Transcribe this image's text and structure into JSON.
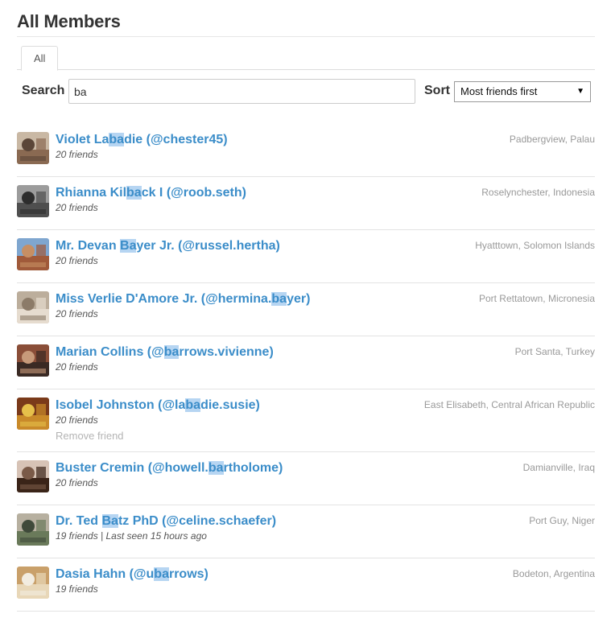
{
  "page": {
    "title": "All Members"
  },
  "tabs": [
    {
      "label": "All"
    }
  ],
  "search": {
    "label": "Search",
    "value": "ba"
  },
  "sort": {
    "label": "Sort",
    "selected": "Most friends first"
  },
  "members": [
    {
      "name_pre": "Violet La",
      "name_hl": "ba",
      "name_post": "die (@chester45)",
      "meta": "20 friends",
      "location": "Padbergview, Palau",
      "avatar": "avatar-violet",
      "colors": [
        "#8a6a52",
        "#c9b8a4",
        "#5b4638"
      ]
    },
    {
      "name_pre": "Rhianna Kil",
      "name_hl": "ba",
      "name_post": "ck I (@roob.seth)",
      "meta": "20 friends",
      "location": "Roselynchester, Indonesia",
      "avatar": "avatar-rhianna",
      "colors": [
        "#4f4f4f",
        "#9c9c9c",
        "#2d2d2d"
      ]
    },
    {
      "name_pre": "Mr. Devan ",
      "name_hl": "Ba",
      "name_post": "yer Jr. (@russel.hertha)",
      "meta": "20 friends",
      "location": "Hyatttown, Solomon Islands",
      "avatar": "avatar-devan",
      "colors": [
        "#a05a3a",
        "#7fa6cf",
        "#c78f63"
      ]
    },
    {
      "name_pre": "Miss Verlie D'Amore Jr. (@hermina.",
      "name_hl": "ba",
      "name_post": "yer)",
      "meta": "20 friends",
      "location": "Port Rettatown, Micronesia",
      "avatar": "avatar-verlie",
      "colors": [
        "#e6dccf",
        "#bcae9c",
        "#8c7b68"
      ]
    },
    {
      "name_pre": "Marian Collins (@",
      "name_hl": "ba",
      "name_post": "rrows.vivienne)",
      "meta": "20 friends",
      "location": "Port Santa, Turkey",
      "avatar": "avatar-marian",
      "colors": [
        "#3a2a24",
        "#8a4e38",
        "#c79a7a"
      ]
    },
    {
      "name_pre": "Isobel Johnston (@la",
      "name_hl": "ba",
      "name_post": "die.susie)",
      "meta": "20 friends",
      "location": "East Elisabeth, Central African Republic",
      "avatar": "avatar-isobel",
      "colors": [
        "#c98a2a",
        "#7a3a1a",
        "#e6c04a"
      ],
      "remove_label": "Remove friend"
    },
    {
      "name_pre": "Buster Cremin (@howell.",
      "name_hl": "ba",
      "name_post": "rtholome)",
      "meta": "20 friends",
      "location": "Damianville, Iraq",
      "avatar": "avatar-buster",
      "colors": [
        "#3a2418",
        "#d7c3b6",
        "#7a5a48"
      ]
    },
    {
      "name_pre": "Dr. Ted ",
      "name_hl": "Ba",
      "name_post": "tz PhD (@celine.schaefer)",
      "meta": "19 friends | Last seen 15 hours ago",
      "location": "Port Guy, Niger",
      "avatar": "avatar-ted",
      "colors": [
        "#6a7a5a",
        "#b7b0a0",
        "#3f4a3a"
      ]
    },
    {
      "name_pre": "Dasia Hahn (@u",
      "name_hl": "ba",
      "name_post": "rrows)",
      "meta": "19 friends",
      "location": "Bodeton, Argentina",
      "avatar": "avatar-dasia",
      "colors": [
        "#e8d7b8",
        "#c9a06a",
        "#f2ece0"
      ]
    }
  ]
}
